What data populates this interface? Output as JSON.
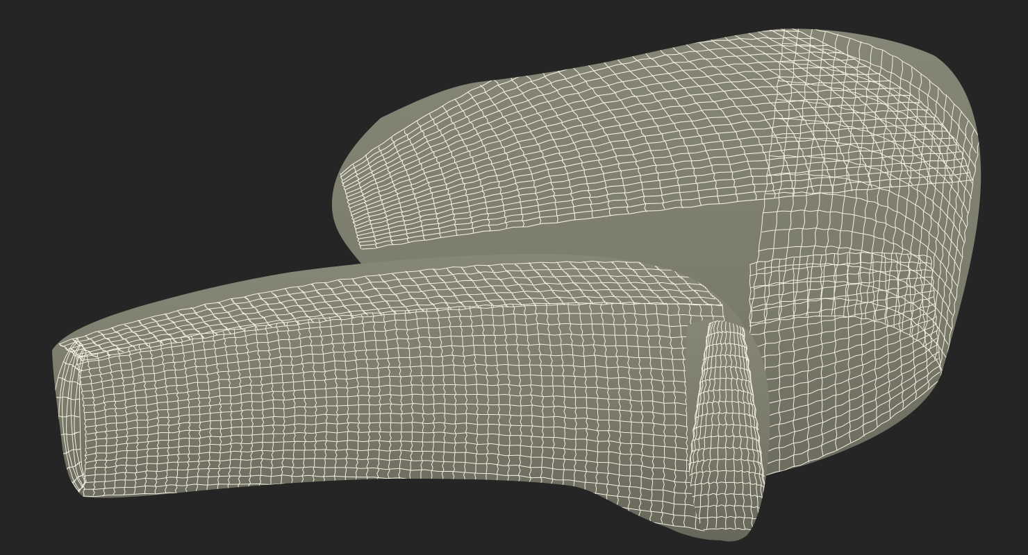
{
  "scene": {
    "subject": "wireframe-3d-model",
    "background_color": "#252525",
    "surface_color": "#7c7c6c",
    "surface_shadow_color": "#63635a",
    "surface_highlight_color": "#8a8a7a",
    "wire_color": "#f4f1e2"
  }
}
